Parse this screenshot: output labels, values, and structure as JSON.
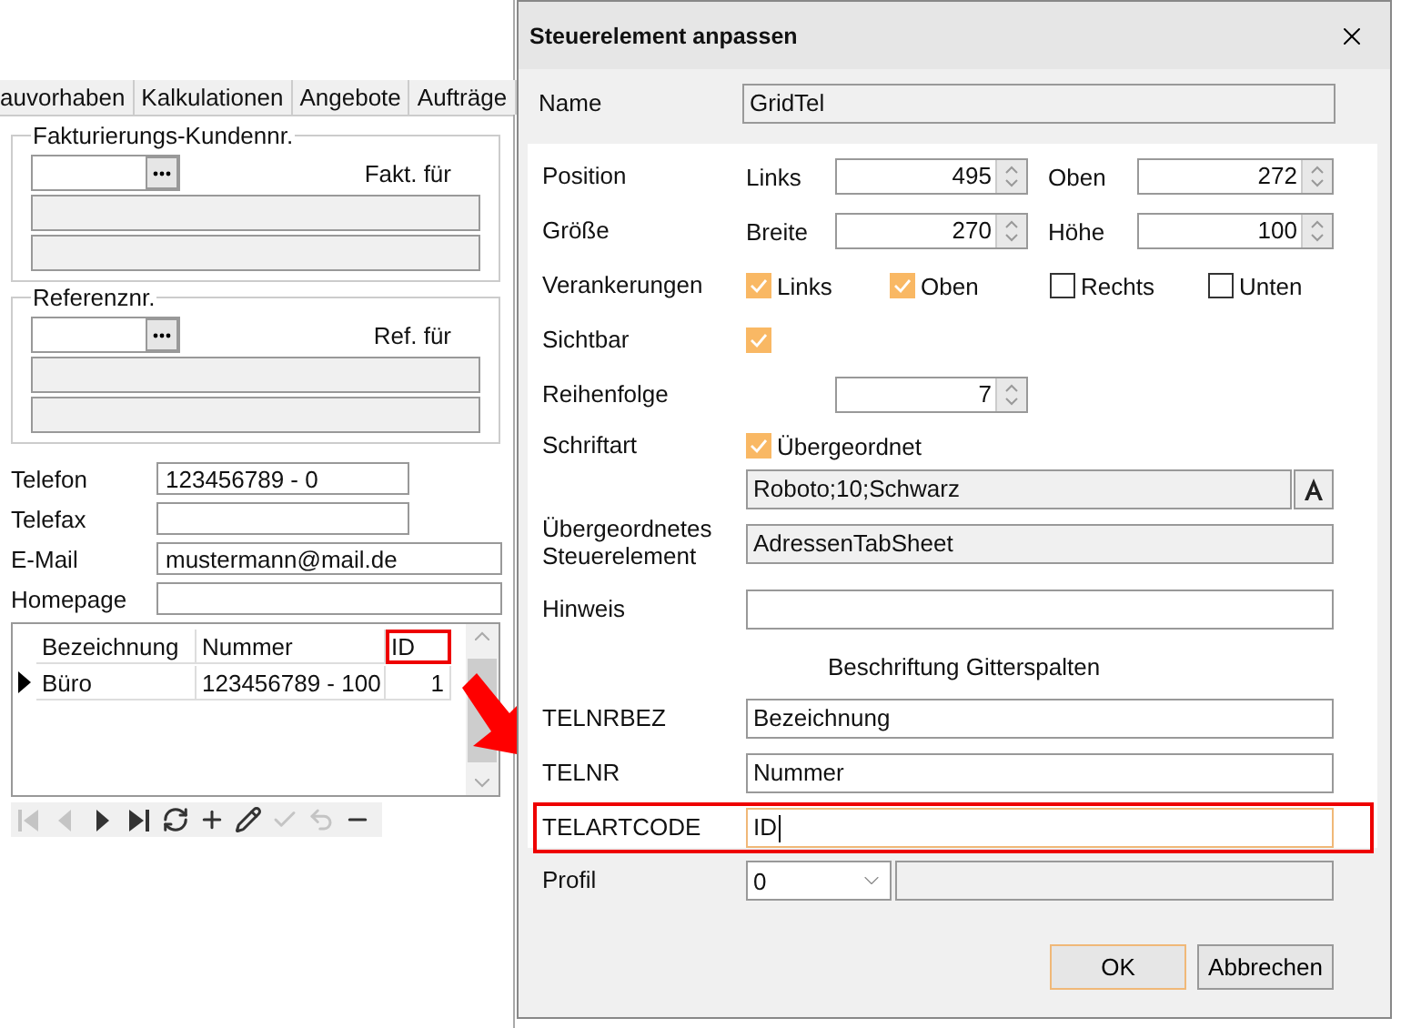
{
  "background_window": {
    "tabs": [
      {
        "label": "auvorhaben",
        "selected": false
      },
      {
        "label": "Kalkulationen",
        "selected": false
      },
      {
        "label": "Angebote",
        "selected": false
      },
      {
        "label": "Aufträge",
        "selected": false
      }
    ],
    "groups": [
      {
        "title": "Fakturierungs-Kundennr.",
        "caption": "Fakt. für"
      },
      {
        "title": "Referenznr.",
        "caption": "Ref. für"
      }
    ],
    "contacts": [
      {
        "label": "Telefon",
        "value": "123456789 - 0",
        "kind": "narrow"
      },
      {
        "label": "Telefax",
        "kind": "narrow"
      },
      {
        "label": "E-Mail",
        "value": "mustermann@mail.de",
        "kind": "wide"
      },
      {
        "label": "Homepage",
        "kind": "wide"
      }
    ],
    "grid": {
      "columns": [
        {
          "label": "Bezeichnung",
          "highlighted": false
        },
        {
          "label": "Nummer",
          "highlighted": false
        },
        {
          "label": "ID",
          "highlighted": true
        }
      ],
      "rows": [
        {
          "cells": [
            "Büro",
            "123456789 - 100",
            "1"
          ],
          "current": true
        }
      ]
    },
    "navigator": [
      {
        "kind": "first",
        "disabled": true
      },
      {
        "kind": "prior",
        "disabled": true
      },
      {
        "kind": "next",
        "disabled": false
      },
      {
        "kind": "last",
        "disabled": false
      },
      {
        "kind": "refresh",
        "disabled": false
      },
      {
        "kind": "add",
        "disabled": false
      },
      {
        "kind": "edit",
        "disabled": false
      },
      {
        "kind": "post",
        "disabled": true
      },
      {
        "kind": "cancel",
        "disabled": true
      },
      {
        "kind": "delete",
        "disabled": false
      }
    ]
  },
  "dialog": {
    "title": "Steuerelement anpassen",
    "name": {
      "label": "Name",
      "value": "GridTel"
    },
    "position": {
      "label": "Position",
      "fields": [
        {
          "label": "Links",
          "value": "495"
        },
        {
          "label": "Oben",
          "value": "272"
        }
      ]
    },
    "size": {
      "label": "Größe",
      "fields": [
        {
          "label": "Breite",
          "value": "270"
        },
        {
          "label": "Höhe",
          "value": "100"
        }
      ]
    },
    "anchors": {
      "label": "Verankerungen",
      "options": [
        {
          "label": "Links",
          "checked": true
        },
        {
          "label": "Oben",
          "checked": true
        },
        {
          "label": "Rechts",
          "checked": false
        },
        {
          "label": "Unten",
          "checked": false
        }
      ]
    },
    "visible": {
      "label": "Sichtbar",
      "checked": true
    },
    "order": {
      "label": "Reihenfolge",
      "value": "7"
    },
    "font": {
      "label": "Schriftart",
      "inherit": {
        "label": "Übergeordnet",
        "checked": true
      },
      "value": "Roboto;10;Schwarz"
    },
    "parent": {
      "label": "Übergeordnetes Steuerelement",
      "value": "AdressenTabSheet"
    },
    "hint": {
      "label": "Hinweis"
    },
    "column_captions": {
      "heading": "Beschriftung Gitterspalten",
      "rows": [
        {
          "label": "TELNRBEZ",
          "value": "Bezeichnung",
          "highlighted": false
        },
        {
          "label": "TELNR",
          "value": "Nummer",
          "highlighted": false
        },
        {
          "label": "TELARTCODE",
          "value": "ID",
          "highlighted": true
        }
      ]
    },
    "profile": {
      "label": "Profil",
      "value": "0"
    },
    "buttons": [
      {
        "label": "OK",
        "default": true
      },
      {
        "label": "Abbrechen",
        "default": false
      }
    ]
  }
}
